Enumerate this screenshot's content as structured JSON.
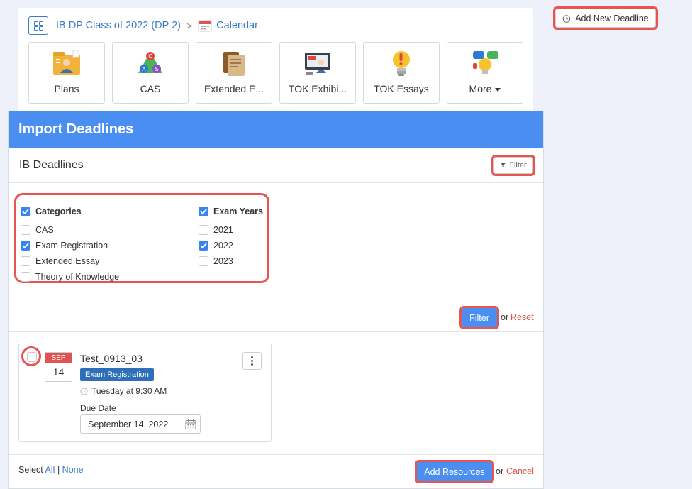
{
  "breadcrumb": {
    "class_name": "IB DP Class of 2022 (DP 2)",
    "separator": ">",
    "calendar": "Calendar"
  },
  "tiles": [
    {
      "label": "Plans",
      "icon": "plans-icon"
    },
    {
      "label": "CAS",
      "icon": "cas-icon"
    },
    {
      "label": "Extended E...",
      "icon": "books-icon"
    },
    {
      "label": "TOK Exhibi...",
      "icon": "presentation-icon"
    },
    {
      "label": "TOK Essays",
      "icon": "lightbulb-icon"
    },
    {
      "label": "More",
      "icon": "chat-bulb-icon"
    }
  ],
  "add_deadline": {
    "label": "Add New Deadline",
    "icon": "clock-icon"
  },
  "modal": {
    "title": "Import Deadlines",
    "section_title": "IB Deadlines",
    "filter_toggle": "Filter"
  },
  "filters": {
    "categories": {
      "label": "Categories",
      "checked": true,
      "items": [
        {
          "label": "CAS",
          "checked": false
        },
        {
          "label": "Exam Registration",
          "checked": true
        },
        {
          "label": "Extended Essay",
          "checked": false
        },
        {
          "label": "Theory of Knowledge",
          "checked": false
        }
      ]
    },
    "exam_years": {
      "label": "Exam Years",
      "checked": true,
      "items": [
        {
          "label": "2021",
          "checked": false
        },
        {
          "label": "2022",
          "checked": true
        },
        {
          "label": "2023",
          "checked": false
        }
      ]
    },
    "apply_label": "Filter",
    "or": "or",
    "reset_label": "Reset"
  },
  "deadline": {
    "month": "SEP",
    "day": "14",
    "title": "Test_0913_03",
    "category": "Exam Registration",
    "time": "Tuesday at 9:30 AM",
    "due_label": "Due Date",
    "due_date": "September 14, 2022"
  },
  "footer": {
    "select": "Select",
    "all": "All",
    "sep": "|",
    "none": "None",
    "add_resources": "Add Resources",
    "or": "or",
    "cancel": "Cancel"
  },
  "colors": {
    "primary": "#4a8ef2",
    "highlight": "#e8554f",
    "badge": "#2d6fb9",
    "link": "#3a7ac9",
    "danger": "#d9534f"
  }
}
